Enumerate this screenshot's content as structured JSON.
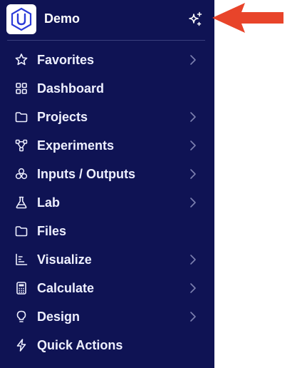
{
  "workspace": {
    "name": "Demo",
    "logo_letter": "U"
  },
  "nav": {
    "items": [
      {
        "label": "Favorites",
        "icon": "star-icon",
        "has_submenu": true
      },
      {
        "label": "Dashboard",
        "icon": "grid-icon",
        "has_submenu": false
      },
      {
        "label": "Projects",
        "icon": "folder-icon",
        "has_submenu": true
      },
      {
        "label": "Experiments",
        "icon": "flow-icon",
        "has_submenu": true
      },
      {
        "label": "Inputs / Outputs",
        "icon": "cluster-icon",
        "has_submenu": true
      },
      {
        "label": "Lab",
        "icon": "flask-icon",
        "has_submenu": true
      },
      {
        "label": "Files",
        "icon": "folder-icon",
        "has_submenu": false
      },
      {
        "label": "Visualize",
        "icon": "chart-icon",
        "has_submenu": true
      },
      {
        "label": "Calculate",
        "icon": "calculator-icon",
        "has_submenu": true
      },
      {
        "label": "Design",
        "icon": "lightbulb-icon",
        "has_submenu": true
      },
      {
        "label": "Quick Actions",
        "icon": "lightning-icon",
        "has_submenu": false
      }
    ]
  },
  "colors": {
    "sidebar_bg": "#0f1354",
    "text": "#eef0ff",
    "chevron": "#7c80b0",
    "annotation_arrow": "#e8442a",
    "logo_blue": "#2b3bd8"
  }
}
